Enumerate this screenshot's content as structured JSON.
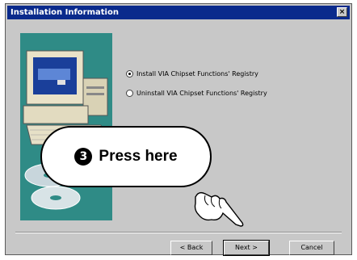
{
  "window": {
    "title": "Installation Information",
    "close_glyph": "×"
  },
  "options": [
    {
      "label": "Install VIA Chipset Functions' Registry",
      "checked": true
    },
    {
      "label": "Uninstall VIA Chipset Functions' Registry",
      "checked": false
    }
  ],
  "buttons": {
    "back": "< Back",
    "next": "Next >",
    "cancel": "Cancel"
  },
  "callout": {
    "step": "3",
    "text": "Press here"
  },
  "colors": {
    "titlebar": "#0a2a8c",
    "art_bg": "#2f8b86",
    "dialog_bg": "#c8c8c8"
  }
}
